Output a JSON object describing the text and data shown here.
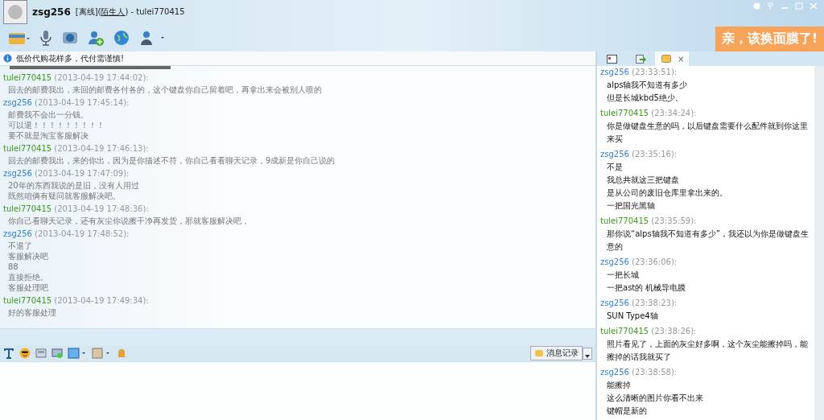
{
  "window": {
    "contact_name": "zsg256",
    "status": "[离线](",
    "relation": "陌生人",
    "title_suffix": ") - tulei770415"
  },
  "ad_banner": {
    "text": "亲，该换面膜了!"
  },
  "notice": {
    "text": "低价代购花样多，代付需谨慎!"
  },
  "chat": {
    "messages": [
      {
        "sender": "tulei770415",
        "kind": "peer",
        "time": "(2013-04-19 17:44:02):",
        "lines": [
          "回去的邮费我出，来回的邮费各付各的，这个键盘你自己留着吧，再拿出来会被别人喷的"
        ]
      },
      {
        "sender": "zsg256",
        "kind": "self",
        "time": "(2013-04-19 17:45:14):",
        "lines": [
          "邮费我不会出一分钱。",
          "可以退！！！！！！！！！",
          "要不就是淘宝客服解决"
        ]
      },
      {
        "sender": "tulei770415",
        "kind": "peer",
        "time": "(2013-04-19 17:46:13):",
        "lines": [
          "回去的邮费我出，来的你出，因为是你描述不符，你自己看看聊天记录，9成新是你自己说的"
        ]
      },
      {
        "sender": "zsg256",
        "kind": "self",
        "time": "(2013-04-19 17:47:09):",
        "lines": [
          "20年的东西我说的是旧，没有人用过",
          "既然咱俩有疑问就客服解决吧。"
        ]
      },
      {
        "sender": "tulei770415",
        "kind": "peer",
        "time": "(2013-04-19 17:48:36):",
        "lines": [
          "你自己看聊天记录，还有灰尘你说擦干净再发货，那就客服解决吧，"
        ]
      },
      {
        "sender": "zsg256",
        "kind": "self",
        "time": "(2013-04-19 17:48:52):",
        "lines": [
          "不退了",
          "客服解决吧",
          "88",
          "直接拒绝。",
          "客服处理吧"
        ]
      },
      {
        "sender": "tulei770415",
        "kind": "peer",
        "time": "(2013-04-19 17:49:34):",
        "lines": [
          "好的客服处理"
        ]
      }
    ]
  },
  "history_button": {
    "label": "消息记录"
  },
  "side_tabs": [
    {
      "selected": false
    },
    {
      "selected": false
    },
    {
      "selected": true,
      "close": "×"
    }
  ],
  "history": {
    "messages": [
      {
        "sender": "zsg256",
        "kind": "self",
        "time": "(23:33:51):",
        "lines": [
          "alps轴我不知道有多少",
          "但是长城kbd5绝少。"
        ]
      },
      {
        "sender": "tulei770415",
        "kind": "peer",
        "time": "(23:34:24):",
        "lines": [
          "你是做键盘生意的吗，以后键盘需要什么配件就到你这里来买"
        ]
      },
      {
        "sender": "zsg256",
        "kind": "self",
        "time": "(23:35:16):",
        "lines": [
          "不是",
          "我总共就这三把键盘",
          "是从公司的废旧仓库里拿出来的。",
          "一把国光黑轴"
        ]
      },
      {
        "sender": "tulei770415",
        "kind": "peer",
        "time": "(23:35:59):",
        "lines": [
          "那你说“alps轴我不知道有多少”，我还以为你是做键盘生意的"
        ]
      },
      {
        "sender": "zsg256",
        "kind": "self",
        "time": "(23:36:06):",
        "lines": [
          "一把长城",
          "一把ast的 机械导电膜"
        ]
      },
      {
        "sender": "zsg256",
        "kind": "self",
        "time": "(23:38:23):",
        "lines": [
          "SUN Type4轴"
        ]
      },
      {
        "sender": "tulei770415",
        "kind": "peer",
        "time": "(23:38:26):",
        "lines": [
          "照片看见了，上面的灰尘好多啊，这个灰尘能擦掉吗，能擦掉的话我就买了"
        ]
      },
      {
        "sender": "zsg256",
        "kind": "self",
        "time": "(23:38:58):",
        "lines": [
          "能擦掉",
          "这么清晰的图片你看不出来",
          "键帽是新的"
        ]
      }
    ]
  }
}
